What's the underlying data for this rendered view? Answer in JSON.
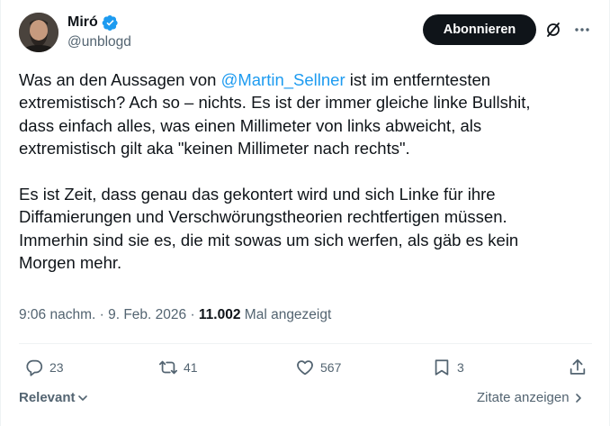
{
  "user": {
    "display_name": "Miró",
    "handle": "@unblogd",
    "verified_icon": "verified-badge-icon"
  },
  "header": {
    "follow_label": "Abonnieren",
    "grok_icon": "grok-slash-icon",
    "more_icon": "more-dots-icon"
  },
  "tweet": {
    "p1_line1_pre": "Was an den Aussagen von ",
    "mention": "@Martin_Sellner",
    "p1_line1_post": " ist im entferntesten",
    "p1_line2": "extremistisch? Ach so – nichts. Es ist der immer gleiche linke Bullshit,",
    "p1_line3": "dass einfach alles, was einen Millimeter von links abweicht, als",
    "p1_line4": "extremistisch gilt aka \"keinen Millimeter nach rechts\".",
    "p2_line1": "Es ist Zeit, dass genau das gekontert wird und sich Linke für ihre",
    "p2_line2": "Diffamierungen und Verschwörungstheorien rechtfertigen müssen.",
    "p2_line3": "Immerhin sind sie es, die mit sowas um sich werfen, als gäb es kein",
    "p2_line4": "Morgen mehr."
  },
  "meta": {
    "time": "9:06 nachm.",
    "separator": " · ",
    "date": "9. Feb. 2026",
    "views_count": "11.002",
    "views_label": " Mal angezeigt"
  },
  "actions": {
    "replies": "23",
    "reposts": "41",
    "likes": "567",
    "bookmarks": "3"
  },
  "footer": {
    "sort_label": "Relevant",
    "quotes_label": "Zitate anzeigen"
  },
  "colors": {
    "accent": "#1d9bf0",
    "text": "#0f1419",
    "secondary": "#536471"
  }
}
